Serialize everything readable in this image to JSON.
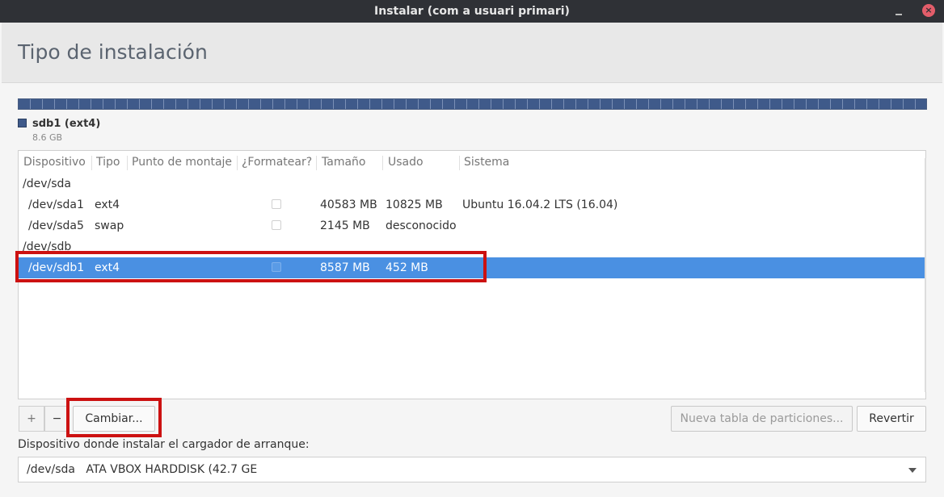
{
  "window": {
    "title": "Instalar (com a usuari primari)"
  },
  "header": {
    "title": "Tipo de instalación"
  },
  "partition_bar": {
    "selected_name": "sdb1 (ext4)",
    "selected_size": "8.6 GB",
    "color": "#3f5a8a"
  },
  "table": {
    "columns": [
      "Dispositivo",
      "Tipo",
      "Punto de montaje",
      "¿Formatear?",
      "Tamaño",
      "Usado",
      "Sistema"
    ],
    "rows": [
      {
        "device": "/dev/sda"
      },
      {
        "device": "/dev/sda1",
        "type": "ext4",
        "size": "40583 MB",
        "used": "10825 MB",
        "system": "Ubuntu 16.04.2 LTS (16.04)",
        "format": false
      },
      {
        "device": "/dev/sda5",
        "type": "swap",
        "size": "2145 MB",
        "used": "desconocido",
        "system": "",
        "format": false
      },
      {
        "device": "/dev/sdb"
      },
      {
        "device": "/dev/sdb1",
        "type": "ext4",
        "size": "8587 MB",
        "used": "452 MB",
        "system": "",
        "format": false,
        "selected": true
      }
    ]
  },
  "toolbar": {
    "add": "+",
    "remove": "−",
    "change": "Cambiar...",
    "new_table": "Nueva tabla de particiones...",
    "revert": "Revertir"
  },
  "bootloader": {
    "label": "Dispositivo donde instalar el cargador de arranque:",
    "value": "/dev/sda   ATA VBOX HARDDISK (42.7 GE"
  },
  "colors": {
    "selection": "#4a90e2",
    "highlight": "#cc1111"
  }
}
